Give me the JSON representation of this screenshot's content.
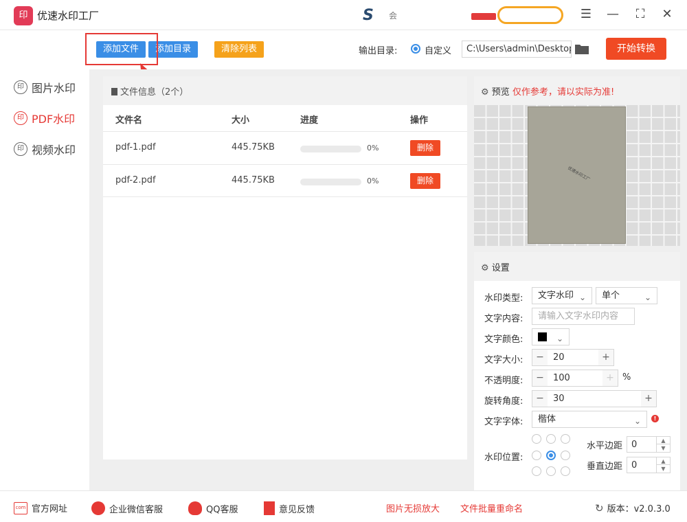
{
  "app": {
    "title": "优速水印工厂",
    "logo_text": "印",
    "partner_logo": "S",
    "partner_text": "会"
  },
  "toolbar": {
    "add_file": "添加文件",
    "add_dir": "添加目录",
    "clear_list": "清除列表",
    "output_label": "输出目录:",
    "output_option": "自定义",
    "output_path": "C:\\Users\\admin\\Desktop",
    "start_button": "开始转换"
  },
  "sidebar": {
    "items": [
      {
        "label": "图片水印",
        "active": false
      },
      {
        "label": "PDF水印",
        "active": true
      },
      {
        "label": "视频水印",
        "active": false
      }
    ]
  },
  "file_panel": {
    "header": "文件信息（2个）",
    "columns": [
      "文件名",
      "大小",
      "进度",
      "操作"
    ],
    "rows": [
      {
        "name": "pdf-1.pdf",
        "size": "445.75KB",
        "progress": 0,
        "progress_text": "0%",
        "action": "删除"
      },
      {
        "name": "pdf-2.pdf",
        "size": "445.75KB",
        "progress": 0,
        "progress_text": "0%",
        "action": "删除"
      }
    ]
  },
  "preview": {
    "title": "预览",
    "warning": "仅作参考，请以实际为准!",
    "watermark_text": "优速水印工厂"
  },
  "settings": {
    "title": "设置",
    "type_label": "水印类型:",
    "type_value": "文字水印",
    "mode_value": "单个",
    "content_label": "文字内容:",
    "content_placeholder": "请输入文字水印内容",
    "color_label": "文字颜色:",
    "color_value": "#000000",
    "size_label": "文字大小:",
    "size_value": "20",
    "opacity_label": "不透明度:",
    "opacity_value": "100",
    "opacity_unit": "%",
    "rotate_label": "旋转角度:",
    "rotate_value": "30",
    "font_label": "文字字体:",
    "font_value": "楷体",
    "position_label": "水印位置:",
    "position_selected": "middle-center",
    "h_margin_label": "水平边距",
    "h_margin_value": "0",
    "v_margin_label": "垂直边距",
    "v_margin_value": "0"
  },
  "footer": {
    "website": "官方网址",
    "wechat": "企业微信客服",
    "qq": "QQ客服",
    "feedback": "意见反馈",
    "enlarge": "图片无损放大",
    "rename": "文件批量重命名",
    "version": "版本：v2.0.3.0",
    "website_icon_text": "com"
  },
  "colors": {
    "accent_blue": "#3a8ee6",
    "accent_red": "#f04a24",
    "accent_orange": "#f5a21b",
    "active_red": "#e53935"
  }
}
